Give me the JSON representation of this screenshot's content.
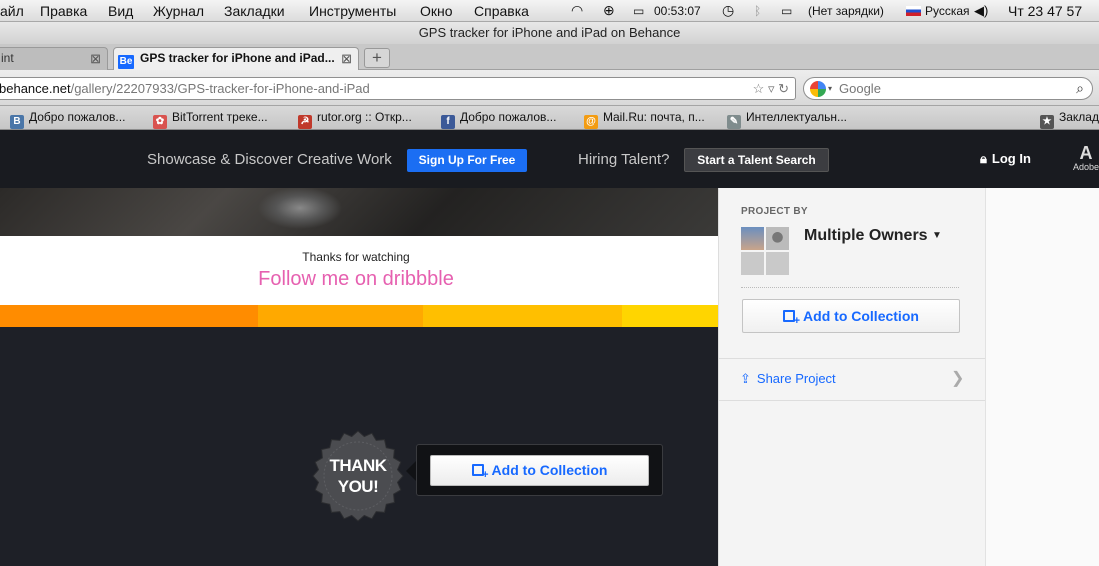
{
  "menubar": {
    "items": [
      "айл",
      "Правка",
      "Вид",
      "Журнал",
      "Закладки",
      "Инструменты",
      "Окно",
      "Справка"
    ],
    "time_elapsed": "00:53:07",
    "battery": "(Нет зарядки)",
    "language": "Русская",
    "clock": "Чт 23 47 57"
  },
  "window": {
    "title": "GPS tracker for iPhone and iPad on Behance"
  },
  "tabs": [
    {
      "label": "int"
    },
    {
      "favicon": "Be",
      "label": "GPS tracker for iPhone and iPad..."
    }
  ],
  "newtab_label": "+",
  "nav": {
    "url_host": "behance.net",
    "url_path": "/gallery/22207933/GPS-tracker-for-iPhone-and-iPad",
    "search_placeholder": "Google"
  },
  "bookmarks": [
    {
      "label": "Добро пожалов...",
      "icon": "В",
      "color": "#4a76a8"
    },
    {
      "label": "BitTorrent треке...",
      "icon": "✿",
      "color": "#d9534f"
    },
    {
      "label": "rutor.org :: Откр...",
      "icon": "☭",
      "color": "#c0392b"
    },
    {
      "label": "Добро пожалов...",
      "icon": "f",
      "color": "#3b5998"
    },
    {
      "label": "Mail.Ru: почта, п...",
      "icon": "@",
      "color": "#f39c12"
    },
    {
      "label": "Интеллектуальн...",
      "icon": "✎",
      "color": "#7f8c8d"
    },
    {
      "label": "Заклад",
      "icon": "★",
      "color": "#555555"
    }
  ],
  "behance_header": {
    "tagline": "Showcase & Discover Creative Work",
    "signup": "Sign Up For Free",
    "hiring": "Hiring Talent?",
    "talent_search": "Start a Talent Search",
    "login": "Log In",
    "adobe_letter": "A",
    "adobe_label": "Adobe"
  },
  "content": {
    "thanks_small": "Thanks for watching",
    "follow": "Follow me on dribbble",
    "badge": "THANK YOU!",
    "add_collection": "Add to Collection"
  },
  "stripe_colors": [
    "#ff8c00",
    "#ffa900",
    "#ffbf00",
    "#ffd500"
  ],
  "sidebar": {
    "project_by": "PROJECT BY",
    "owners": "Multiple Owners",
    "add_collection": "Add to Collection",
    "share": "Share Project"
  }
}
